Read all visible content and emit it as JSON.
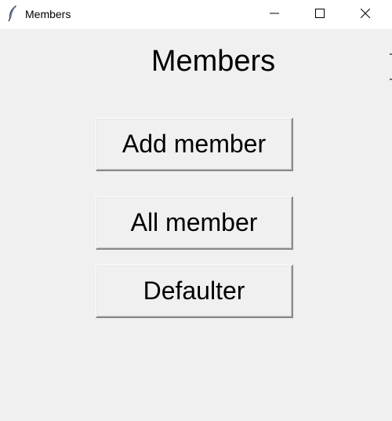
{
  "window": {
    "title": "Members",
    "icon": "feather-icon",
    "controls": [
      "minimize-icon",
      "maximize-icon",
      "close-icon"
    ]
  },
  "heading": "Members",
  "buttons": {
    "add_member": "Add member",
    "all_member": "All member",
    "defaulter": "Defaulter"
  },
  "colors": {
    "window_background": "#f0f0f0",
    "titlebar_background": "#ffffff",
    "text": "#000000"
  }
}
